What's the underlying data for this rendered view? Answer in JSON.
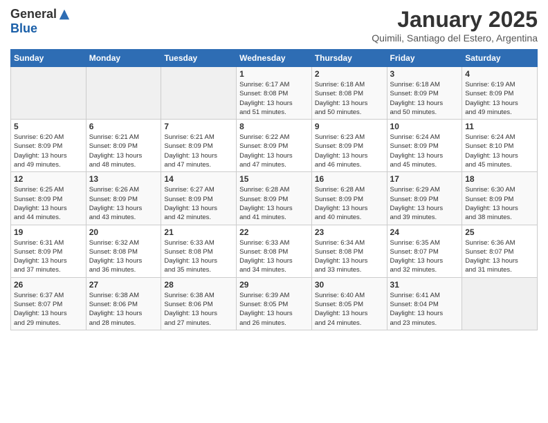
{
  "header": {
    "logo_general": "General",
    "logo_blue": "Blue",
    "month_title": "January 2025",
    "subtitle": "Quimili, Santiago del Estero, Argentina"
  },
  "days_of_week": [
    "Sunday",
    "Monday",
    "Tuesday",
    "Wednesday",
    "Thursday",
    "Friday",
    "Saturday"
  ],
  "weeks": [
    [
      {
        "day": "",
        "info": ""
      },
      {
        "day": "",
        "info": ""
      },
      {
        "day": "",
        "info": ""
      },
      {
        "day": "1",
        "info": "Sunrise: 6:17 AM\nSunset: 8:08 PM\nDaylight: 13 hours\nand 51 minutes."
      },
      {
        "day": "2",
        "info": "Sunrise: 6:18 AM\nSunset: 8:08 PM\nDaylight: 13 hours\nand 50 minutes."
      },
      {
        "day": "3",
        "info": "Sunrise: 6:18 AM\nSunset: 8:09 PM\nDaylight: 13 hours\nand 50 minutes."
      },
      {
        "day": "4",
        "info": "Sunrise: 6:19 AM\nSunset: 8:09 PM\nDaylight: 13 hours\nand 49 minutes."
      }
    ],
    [
      {
        "day": "5",
        "info": "Sunrise: 6:20 AM\nSunset: 8:09 PM\nDaylight: 13 hours\nand 49 minutes."
      },
      {
        "day": "6",
        "info": "Sunrise: 6:21 AM\nSunset: 8:09 PM\nDaylight: 13 hours\nand 48 minutes."
      },
      {
        "day": "7",
        "info": "Sunrise: 6:21 AM\nSunset: 8:09 PM\nDaylight: 13 hours\nand 47 minutes."
      },
      {
        "day": "8",
        "info": "Sunrise: 6:22 AM\nSunset: 8:09 PM\nDaylight: 13 hours\nand 47 minutes."
      },
      {
        "day": "9",
        "info": "Sunrise: 6:23 AM\nSunset: 8:09 PM\nDaylight: 13 hours\nand 46 minutes."
      },
      {
        "day": "10",
        "info": "Sunrise: 6:24 AM\nSunset: 8:09 PM\nDaylight: 13 hours\nand 45 minutes."
      },
      {
        "day": "11",
        "info": "Sunrise: 6:24 AM\nSunset: 8:10 PM\nDaylight: 13 hours\nand 45 minutes."
      }
    ],
    [
      {
        "day": "12",
        "info": "Sunrise: 6:25 AM\nSunset: 8:09 PM\nDaylight: 13 hours\nand 44 minutes."
      },
      {
        "day": "13",
        "info": "Sunrise: 6:26 AM\nSunset: 8:09 PM\nDaylight: 13 hours\nand 43 minutes."
      },
      {
        "day": "14",
        "info": "Sunrise: 6:27 AM\nSunset: 8:09 PM\nDaylight: 13 hours\nand 42 minutes."
      },
      {
        "day": "15",
        "info": "Sunrise: 6:28 AM\nSunset: 8:09 PM\nDaylight: 13 hours\nand 41 minutes."
      },
      {
        "day": "16",
        "info": "Sunrise: 6:28 AM\nSunset: 8:09 PM\nDaylight: 13 hours\nand 40 minutes."
      },
      {
        "day": "17",
        "info": "Sunrise: 6:29 AM\nSunset: 8:09 PM\nDaylight: 13 hours\nand 39 minutes."
      },
      {
        "day": "18",
        "info": "Sunrise: 6:30 AM\nSunset: 8:09 PM\nDaylight: 13 hours\nand 38 minutes."
      }
    ],
    [
      {
        "day": "19",
        "info": "Sunrise: 6:31 AM\nSunset: 8:09 PM\nDaylight: 13 hours\nand 37 minutes."
      },
      {
        "day": "20",
        "info": "Sunrise: 6:32 AM\nSunset: 8:08 PM\nDaylight: 13 hours\nand 36 minutes."
      },
      {
        "day": "21",
        "info": "Sunrise: 6:33 AM\nSunset: 8:08 PM\nDaylight: 13 hours\nand 35 minutes."
      },
      {
        "day": "22",
        "info": "Sunrise: 6:33 AM\nSunset: 8:08 PM\nDaylight: 13 hours\nand 34 minutes."
      },
      {
        "day": "23",
        "info": "Sunrise: 6:34 AM\nSunset: 8:08 PM\nDaylight: 13 hours\nand 33 minutes."
      },
      {
        "day": "24",
        "info": "Sunrise: 6:35 AM\nSunset: 8:07 PM\nDaylight: 13 hours\nand 32 minutes."
      },
      {
        "day": "25",
        "info": "Sunrise: 6:36 AM\nSunset: 8:07 PM\nDaylight: 13 hours\nand 31 minutes."
      }
    ],
    [
      {
        "day": "26",
        "info": "Sunrise: 6:37 AM\nSunset: 8:07 PM\nDaylight: 13 hours\nand 29 minutes."
      },
      {
        "day": "27",
        "info": "Sunrise: 6:38 AM\nSunset: 8:06 PM\nDaylight: 13 hours\nand 28 minutes."
      },
      {
        "day": "28",
        "info": "Sunrise: 6:38 AM\nSunset: 8:06 PM\nDaylight: 13 hours\nand 27 minutes."
      },
      {
        "day": "29",
        "info": "Sunrise: 6:39 AM\nSunset: 8:05 PM\nDaylight: 13 hours\nand 26 minutes."
      },
      {
        "day": "30",
        "info": "Sunrise: 6:40 AM\nSunset: 8:05 PM\nDaylight: 13 hours\nand 24 minutes."
      },
      {
        "day": "31",
        "info": "Sunrise: 6:41 AM\nSunset: 8:04 PM\nDaylight: 13 hours\nand 23 minutes."
      },
      {
        "day": "",
        "info": ""
      }
    ]
  ]
}
